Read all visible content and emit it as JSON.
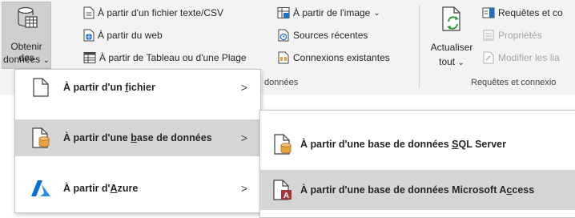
{
  "ribbon": {
    "get_data": {
      "line1": "Obtenir des",
      "line2": "données",
      "caret": "⌄"
    },
    "col1": {
      "from_text_csv": "À partir d'un fichier texte/CSV",
      "from_web": "À partir du web",
      "from_table_range": "À partir de Tableau ou d'une Plage"
    },
    "col2": {
      "from_image": "À partir de l'image",
      "from_image_caret": "⌄",
      "recent_sources": "Sources récentes",
      "existing_connections": "Connexions existantes"
    },
    "group_get_transform_label": "données",
    "refresh": {
      "line1": "Actualiser",
      "line2": "tout",
      "caret": "⌄"
    },
    "col3": {
      "queries_connections": "Requêtes et co",
      "properties": "Propriétés",
      "edit_links": "Modifier les lia"
    },
    "group_queries_label": "Requêtes et connexio"
  },
  "menu_level1": {
    "items": [
      {
        "pre": "À partir d'un ",
        "key": "f",
        "post": "ichier",
        "chevron": ">"
      },
      {
        "pre": "À partir d'une ",
        "key": "b",
        "post": "ase de données",
        "chevron": ">"
      },
      {
        "pre": "À partir d'",
        "key": "A",
        "post": "zure",
        "chevron": ">"
      }
    ]
  },
  "menu_level2": {
    "items": [
      {
        "pre": "À partir d'une base de données ",
        "key": "S",
        "post": "QL Server"
      },
      {
        "pre": "À partir d'une base de données Microsoft A",
        "key": "c",
        "post": "cess"
      }
    ]
  },
  "colors": {
    "ribbon_bg": "#f3f3f3",
    "selected_bg": "#d5d5d5",
    "db_cylinder": "#e8a33d",
    "access_red": "#a4373a",
    "azure_blue": "#0a6ed1"
  }
}
